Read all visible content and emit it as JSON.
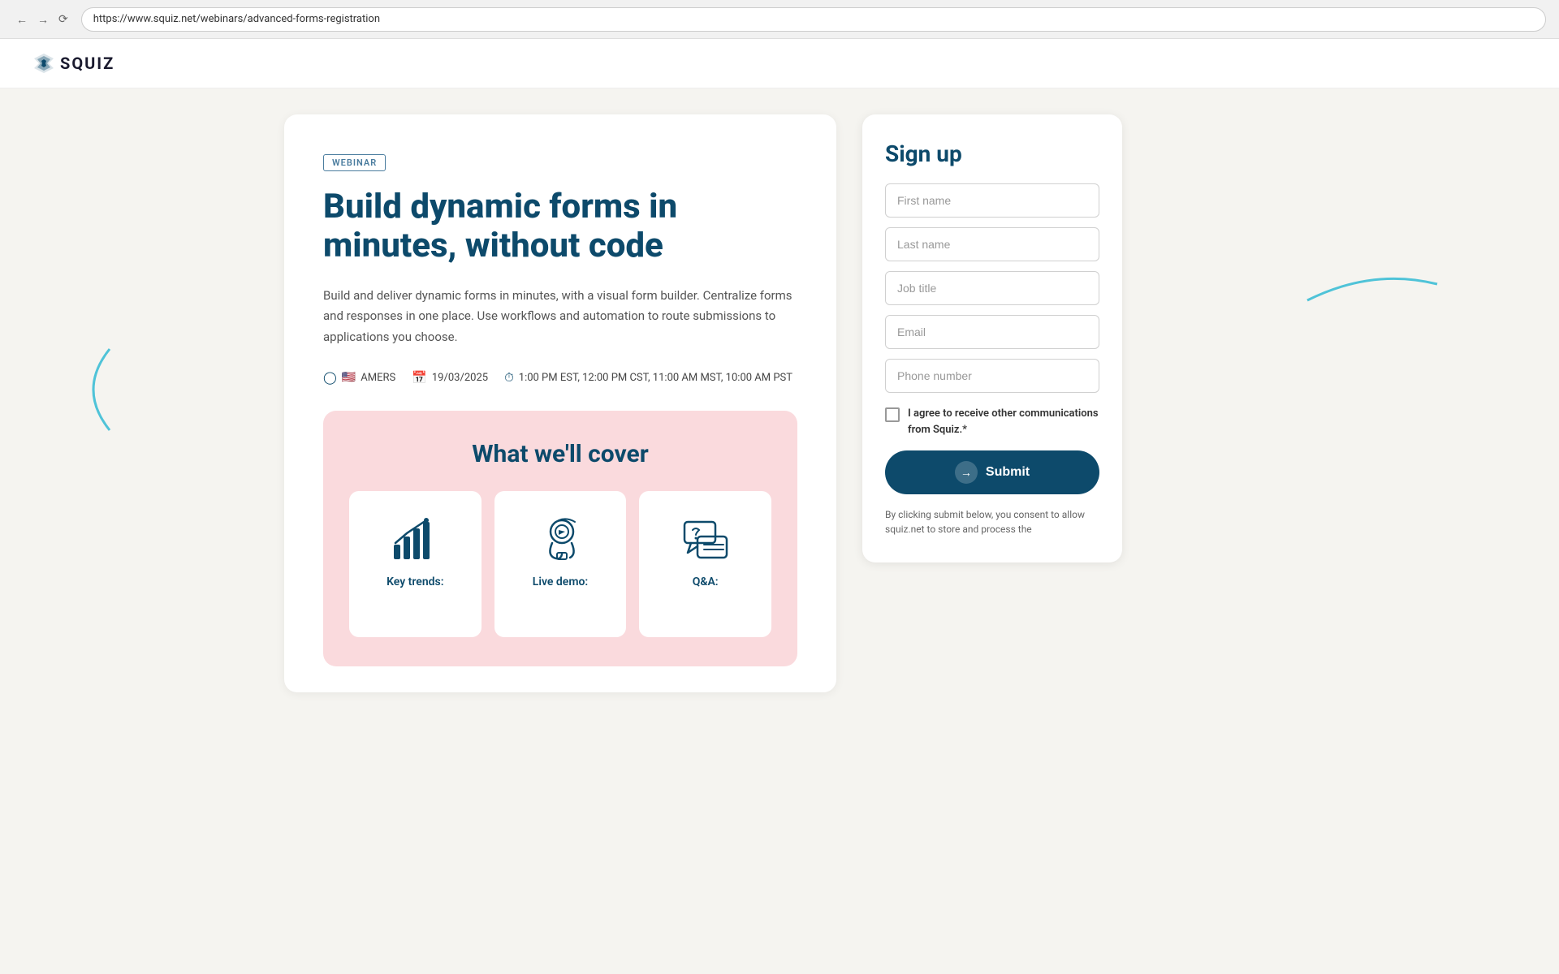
{
  "browser": {
    "url": "https://www.squiz.net/webinars/advanced-forms-registration",
    "back_disabled": false,
    "forward_disabled": true
  },
  "header": {
    "logo_text": "SQUIZ"
  },
  "webinar": {
    "badge": "WEBINAR",
    "title": "Build dynamic forms in minutes, without code",
    "description": "Build and deliver dynamic forms in minutes, with a visual form builder. Centralize forms and responses in one place. Use workflows and automation to route submissions to applications you choose.",
    "region_label": "AMERS",
    "date": "19/03/2025",
    "times": "1:00 PM EST,  12:00 PM CST,  11:00 AM MST,  10:00 AM PST",
    "cover_title": "What we'll cover",
    "cover_items": [
      {
        "label": "Key trends:"
      },
      {
        "label": "Live demo:"
      },
      {
        "label": "Q&A:"
      }
    ]
  },
  "form": {
    "title": "Sign up",
    "fields": {
      "first_name": "First name",
      "last_name": "Last name",
      "job_title": "Job title",
      "email": "Email",
      "phone": "Phone number"
    },
    "checkbox_label": "I agree to receive other communications from Squiz.*",
    "submit_label": "Submit",
    "consent_text": "By clicking submit below, you consent to allow squiz.net to store and process the"
  }
}
